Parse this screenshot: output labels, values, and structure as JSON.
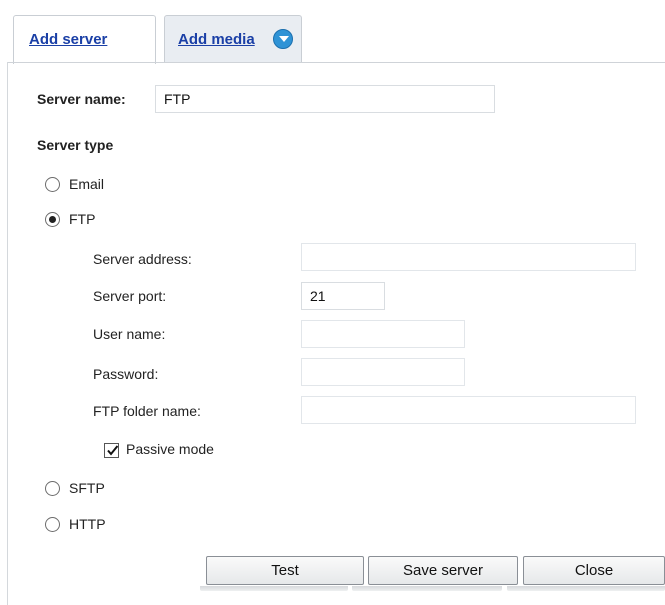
{
  "tabs": [
    {
      "label": "Add server",
      "active": true
    },
    {
      "label": "Add media",
      "active": false,
      "icon": "chevron-down-circle-icon"
    }
  ],
  "form": {
    "server_name_label": "Server name:",
    "server_name_value": "FTP",
    "server_type_label": "Server type",
    "types": [
      "Email",
      "FTP",
      "SFTP",
      "HTTP"
    ],
    "selected_type": "FTP",
    "ftp": {
      "server_address_label": "Server address:",
      "server_address_value": "",
      "server_port_label": "Server port:",
      "server_port_value": "21",
      "user_name_label": "User name:",
      "user_name_value": "",
      "password_label": "Password:",
      "password_value": "",
      "folder_label": "FTP folder name:",
      "folder_value": "",
      "passive_mode_label": "Passive mode",
      "passive_mode_checked": true
    }
  },
  "buttons": {
    "test": "Test",
    "save": "Save server",
    "close": "Close"
  },
  "colors": {
    "tab_link": "#1a3fa6",
    "tab_icon": "#2f93d6"
  }
}
